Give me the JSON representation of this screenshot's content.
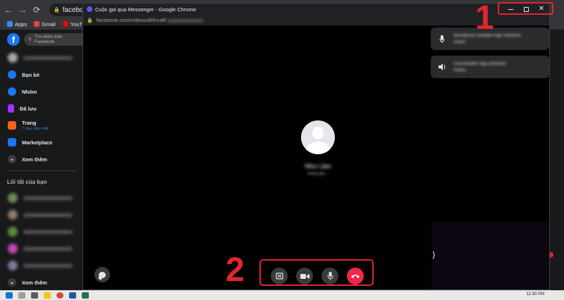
{
  "bg_browser": {
    "omnibox_text": "facebook.com",
    "bookmarks": [
      {
        "label": "Apps",
        "color": "#4285f4"
      },
      {
        "label": "Gmail",
        "color": "#ea4335"
      },
      {
        "label": "YouTube",
        "color": "#ff0000"
      }
    ]
  },
  "facebook": {
    "logo_letter": "f",
    "search_placeholder": "Tìm kiếm trên Facebook",
    "menu": [
      {
        "label": "Bạn bè",
        "icon": "friends-icon",
        "color": "#1877f2"
      },
      {
        "label": "Nhóm",
        "icon": "groups-icon",
        "color": "#1877f2"
      },
      {
        "label": "Đã lưu",
        "icon": "saved-icon",
        "color": "#a033ff"
      },
      {
        "label": "Trang",
        "sub": "7 mục cập nhật",
        "icon": "pages-icon",
        "color": "#f7631b"
      },
      {
        "label": "Marketplace",
        "icon": "marketplace-icon",
        "color": "#1877f2"
      },
      {
        "label": "Xem thêm",
        "icon": "chevron-down-icon",
        "color": "#3a3b3c"
      }
    ],
    "shortcuts_title": "Lối tắt của bạn",
    "see_more_bottom": "Xem thêm"
  },
  "call_window": {
    "title": "Cuộc gọi qua Messenger - Google Chrome",
    "url": "facebook.com/videocall/incall/",
    "accent_color": "#0084ff",
    "end_call_color": "#f02849"
  },
  "call": {
    "caller_name": "Như Lâm",
    "status": "Đang gọi..."
  },
  "devices": [
    {
      "icon": "microphone-icon",
      "line1": "Microphone (Realtek High Definition",
      "line2": "Audio)"
    },
    {
      "icon": "speaker-icon",
      "line1": "Loa (Realtek High Definition",
      "line2": "Audio)"
    }
  ],
  "annotations": {
    "label_1": "1",
    "label_2": "2",
    "color": "#e2262e"
  },
  "taskbar": {
    "clock": "11:30 PM"
  }
}
